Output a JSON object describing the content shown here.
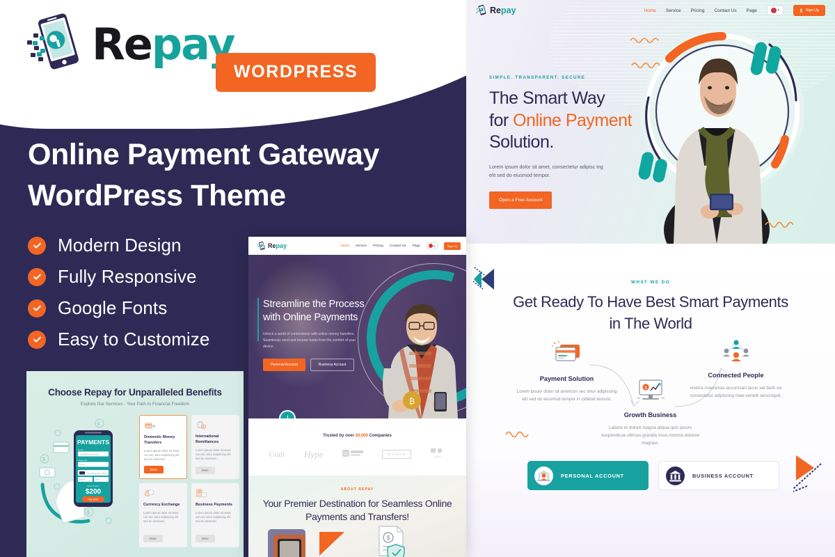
{
  "promo": {
    "brand": {
      "name_prefix": "Re",
      "name_suffix": "pay",
      "full": "Repay"
    },
    "platform_badge": "WORDPRESS",
    "headline": "Online Payment Gateway WordPress Theme",
    "features": [
      {
        "label": "Modern Design",
        "icon": "check-icon"
      },
      {
        "label": "Fully Responsive",
        "icon": "check-icon"
      },
      {
        "label": "Google Fonts",
        "icon": "check-icon"
      },
      {
        "label": "Easy to Customize",
        "icon": "check-icon"
      }
    ],
    "colors": {
      "navy": "#2e2a55",
      "orange": "#f26522",
      "teal": "#17a2a0",
      "white": "#ffffff"
    }
  },
  "benefits_mockup": {
    "title": "Choose Repay for Unparalleled Benefits",
    "subtitle": "Explore Our Services - Your Path to Financial Freedom",
    "phone": {
      "header": "PAYMENTS",
      "field_label_1": "Email",
      "field_value_1": "email@example.com",
      "field_label_2": "Password",
      "field_value_2": "••••••••",
      "card_hint": "Card Number",
      "expiry": "MM/YY",
      "cvc": "CVC",
      "amount_label": "Action Figure",
      "amount": "$200",
      "pay_button": "Pay $200"
    },
    "cards": [
      {
        "title": "Domestic Money Transfers",
        "text": "Lorem ipsum dolor sit amet con sec tetur adipiscing elit sed do eiusmod.",
        "button": "More",
        "featured": true,
        "icon": "bank-transfer-icon"
      },
      {
        "title": "International Remittances",
        "text": "Lorem ipsum dolor sit amet con sec tetur adipiscing elit sed do eiusmod.",
        "button": "More",
        "featured": false,
        "icon": "globe-coin-icon"
      },
      {
        "title": "Currency Exchange",
        "text": "Lorem ipsum dolor sit amet con sec tetur adipiscing elit sed do eiusmod.",
        "button": "More",
        "featured": false,
        "icon": "exchange-coins-icon"
      },
      {
        "title": "Business Payments",
        "text": "Lorem ipsum dolor sit amet con sec tetur adipiscing elit sed do eiusmod.",
        "button": "More",
        "featured": false,
        "icon": "business-payment-icon"
      }
    ]
  },
  "center_mockup": {
    "nav": {
      "logo": "Repay",
      "items": [
        "Home",
        "Service",
        "Pricing",
        "Contact Us",
        "Page"
      ],
      "active": "Home",
      "language_flag": "uk-flag-icon",
      "signup_label": "Sign Up"
    },
    "hero": {
      "heading": "Streamline the Process with Online Payments",
      "paragraph": "Unlock a world of convenience with online money transfers. Seamlessly send and receive funds from the comfort of your device.",
      "button_primary": "Personal Account",
      "button_secondary": "Business Account",
      "scroll_badge": "scroll-down-icon"
    },
    "trusted": {
      "text_before": "Trusted by over ",
      "count": "30,000",
      "text_after": " Companies",
      "logos": [
        "Craft",
        "Hype",
        "OC",
        "MINIMUM",
        "logoi"
      ]
    },
    "about": {
      "kicker": "ABOUT REPAY",
      "heading": "Your Premier Destination for Seamless Online Payments and Transfers!"
    }
  },
  "right_top": {
    "nav": {
      "logo": "Repay",
      "items": [
        "Home",
        "Service",
        "Pricing",
        "Contact Us",
        "Page"
      ],
      "active": "Home",
      "language_flag": "uk-flag-icon",
      "signup_label": "Sign Up"
    },
    "hero": {
      "kicker": "SIMPLE. TRANSPARENT. SECURE",
      "heading_line_1": "The Smart Way",
      "heading_line_2_plain": "for ",
      "heading_line_2_highlight": "Online Payment",
      "heading_line_3": "Solution.",
      "paragraph": "Lorem ipsum dolor sit amet, consectetur adipisc ing elit sed do eiusmod tempor.",
      "cta_label": "Open a Free Account"
    }
  },
  "right_bottom": {
    "kicker": "WHAT WE DO",
    "heading": "Get Ready To Have Best Smart Payments in The World",
    "steps": [
      {
        "title": "Payment Solution",
        "text": "Lorem ipsum dolor sit ametcon sec tetur adipiscing elit sed do eiusmod tempor in cididod temunt.",
        "icon": "credit-cards-icon"
      },
      {
        "title": "Growth Business",
        "text": "Labore et dolore magna aliqua quis ipsum suspendisse ultrices gravida risus commo ddolore magnao.",
        "icon": "monitor-chart-icon"
      },
      {
        "title": "Connected People",
        "text": "viverra maecenas accumsan lacus vel facili sis consectetur adipiscing mae-cenelit seiscingsd.",
        "icon": "connected-people-icon"
      }
    ],
    "accounts": [
      {
        "label": "PERSONAL ACCOUNT",
        "icon": "personal-account-icon",
        "active": true
      },
      {
        "label": "BUSINESS ACCOUNT",
        "icon": "business-bank-icon",
        "active": false
      }
    ]
  }
}
